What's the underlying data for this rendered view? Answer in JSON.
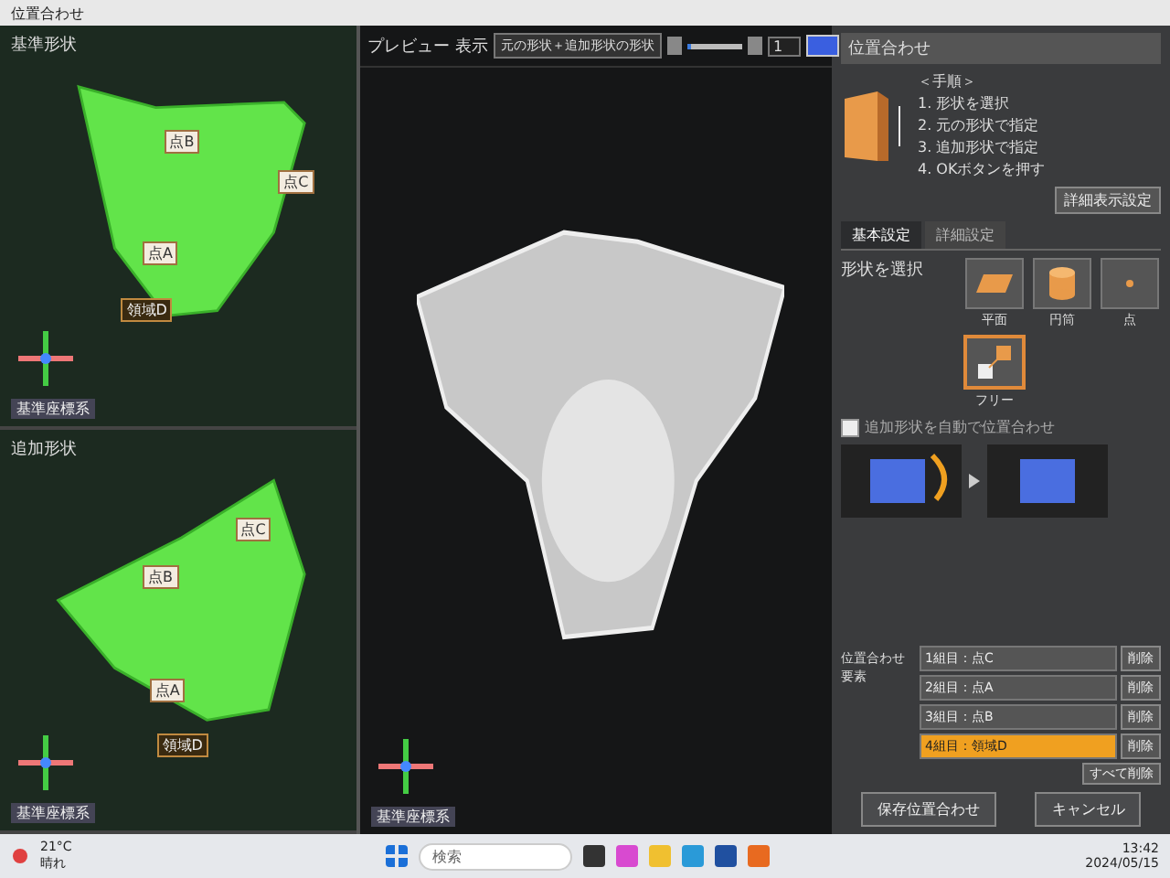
{
  "window": {
    "title": "位置合わせ"
  },
  "left_views": [
    {
      "title": "基準形状",
      "labels": [
        {
          "text": "点B",
          "kind": "point"
        },
        {
          "text": "点C",
          "kind": "point"
        },
        {
          "text": "点A",
          "kind": "point"
        },
        {
          "text": "領域D",
          "kind": "region"
        }
      ],
      "axis_label": "基準座標系"
    },
    {
      "title": "追加形状",
      "labels": [
        {
          "text": "点C",
          "kind": "point"
        },
        {
          "text": "点B",
          "kind": "point"
        },
        {
          "text": "点A",
          "kind": "point"
        },
        {
          "text": "領域D",
          "kind": "region"
        }
      ],
      "axis_label": "基準座標系"
    }
  ],
  "preview": {
    "title": "プレビュー",
    "display_label": "表示",
    "display_select": "元の形状＋追加形状の形状",
    "slider": {
      "level": 0.08
    },
    "number_value": "1",
    "color": "#3a5fe0",
    "axis_label": "基準座標系"
  },
  "panel": {
    "title": "位置合わせ",
    "steps_heading": "＜手順＞",
    "steps": [
      "1. 形状を選択",
      "2. 元の形状で指定",
      "3. 追加形状で指定",
      "4. OKボタンを押す"
    ],
    "settings_button": "詳細表示設定",
    "tabs": [
      {
        "label": "基本設定",
        "selected": true
      },
      {
        "label": "詳細設定",
        "selected": false
      }
    ],
    "shape_label": "形状を選択",
    "shapes": [
      {
        "label": "平面",
        "kind": "plane",
        "selected": false
      },
      {
        "label": "円筒",
        "kind": "cylinder",
        "selected": false
      },
      {
        "label": "点",
        "kind": "point",
        "selected": false
      },
      {
        "label": "フリー",
        "kind": "free",
        "selected": true
      }
    ],
    "option": {
      "label": "追加形状を自動で位置合わせ",
      "checked": false
    },
    "pairs_label": "位置合わせ要素",
    "pairs": [
      {
        "text": "1組目：点C",
        "selected": false,
        "action": "削除"
      },
      {
        "text": "2組目：点A",
        "selected": false,
        "action": "削除"
      },
      {
        "text": "3組目：点B",
        "selected": false,
        "action": "削除"
      },
      {
        "text": "4組目：領域D",
        "selected": true,
        "action": "削除"
      }
    ],
    "delete_all": "すべて削除",
    "buttons": [
      "保存位置合わせ",
      "キャンセル"
    ]
  },
  "taskbar": {
    "weather": "21°C",
    "weather_sub": "晴れ",
    "search_placeholder": "検索",
    "time": "13:42",
    "date": "2024/05/15"
  }
}
